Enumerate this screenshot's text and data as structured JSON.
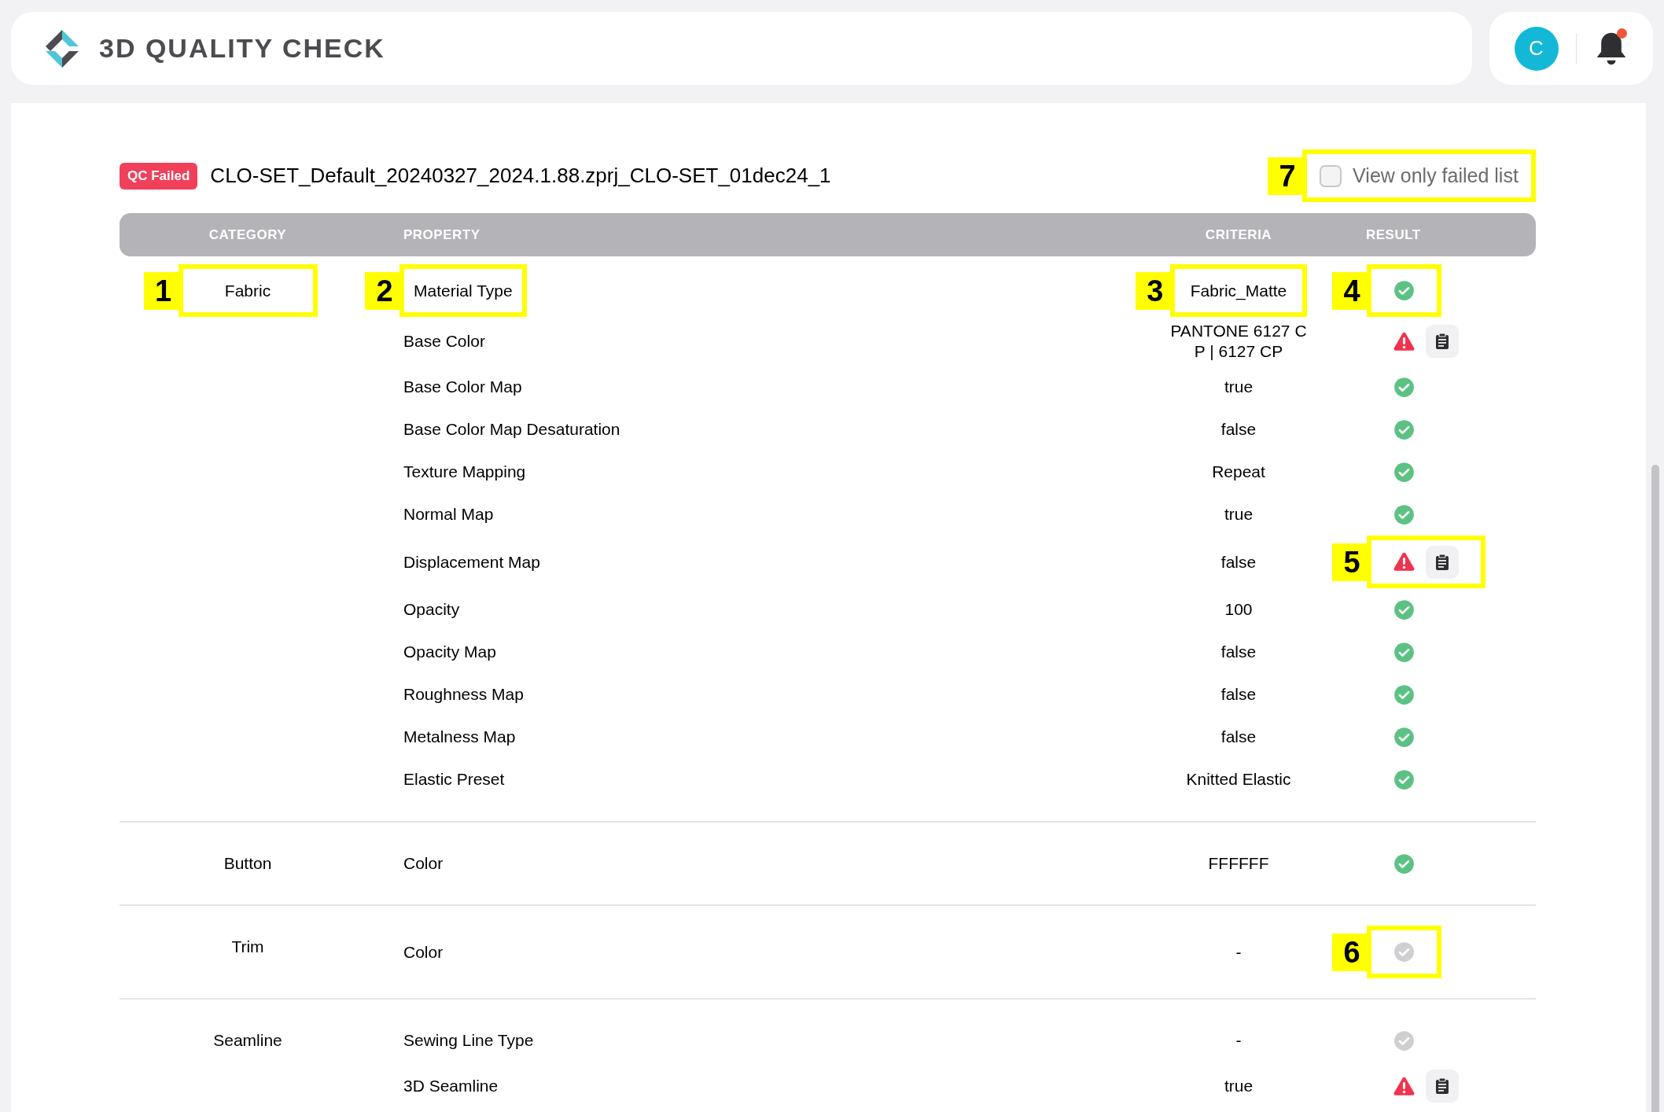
{
  "app_title": "3D QUALITY CHECK",
  "user": {
    "initial": "C",
    "has_notification": true
  },
  "report": {
    "status": "QC Failed",
    "file_name": "CLO-SET_Default_20240327_2024.1.88.zprj_CLO-SET_01dec24_1"
  },
  "filter": {
    "label": "View only failed list",
    "checked": false,
    "callout": "7"
  },
  "table": {
    "columns": [
      "CATEGORY",
      "PROPERTY",
      "CRITERIA",
      "RESULT"
    ],
    "groups": [
      {
        "category": "Fabric",
        "category_callout": "1",
        "rows": [
          {
            "property": "Material Type",
            "property_callout": "2",
            "criteria": "Fabric_Matte",
            "criteria_callout": "3",
            "kind": "pass",
            "result_callout": "4"
          },
          {
            "property": "Base Color",
            "criteria": "PANTONE 6127 C\nP | 6127 CP",
            "kind": "fail"
          },
          {
            "property": "Base Color Map",
            "criteria": "true",
            "kind": "pass"
          },
          {
            "property": "Base Color Map Desaturation",
            "criteria": "false",
            "kind": "pass"
          },
          {
            "property": "Texture Mapping",
            "criteria": "Repeat",
            "kind": "pass"
          },
          {
            "property": "Normal Map",
            "criteria": "true",
            "kind": "pass"
          },
          {
            "property": "Displacement Map",
            "criteria": "false",
            "kind": "fail",
            "result_callout": "5"
          },
          {
            "property": "Opacity",
            "criteria": "100",
            "kind": "pass"
          },
          {
            "property": "Opacity Map",
            "criteria": "false",
            "kind": "pass"
          },
          {
            "property": "Roughness Map",
            "criteria": "false",
            "kind": "pass"
          },
          {
            "property": "Metalness Map",
            "criteria": "false",
            "kind": "pass"
          },
          {
            "property": "Elastic Preset",
            "criteria": "Knitted Elastic",
            "kind": "pass"
          }
        ]
      },
      {
        "category": "Button",
        "rows": [
          {
            "property": "Color",
            "criteria": "FFFFFF",
            "kind": "pass"
          }
        ]
      },
      {
        "category": "Trim",
        "rows": [
          {
            "property": "Color",
            "criteria": "-",
            "kind": "na",
            "result_callout": "6"
          }
        ]
      },
      {
        "category": "Seamline",
        "rows": [
          {
            "property": "Sewing Line Type",
            "criteria": "-",
            "kind": "na"
          },
          {
            "property": "3D Seamline",
            "criteria": "true",
            "kind": "fail"
          }
        ]
      }
    ]
  }
}
